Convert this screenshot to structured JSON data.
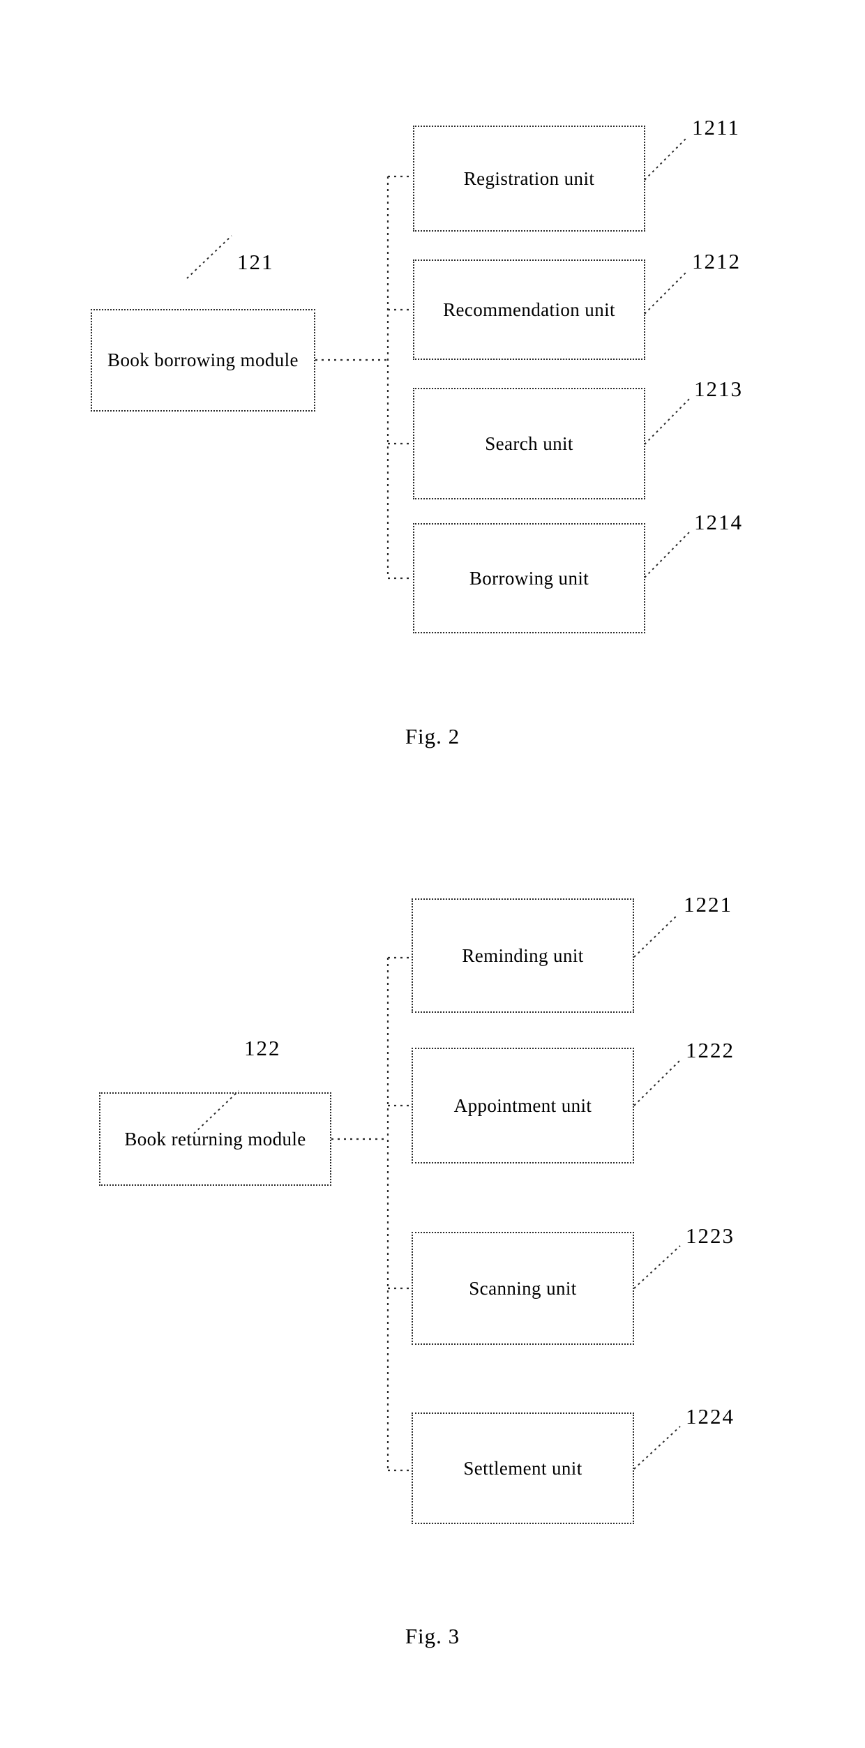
{
  "document": {
    "type": "patent-figure-sheet",
    "background_color": "#ffffff",
    "ink_color": "#000000"
  },
  "figures": [
    {
      "id": "fig2",
      "caption": "Fig. 2",
      "parent": {
        "label": "Book borrowing module",
        "ref": "121"
      },
      "children": [
        {
          "label": "Registration unit",
          "ref": "1211"
        },
        {
          "label": "Recommendation unit",
          "ref": "1212"
        },
        {
          "label": "Search unit",
          "ref": "1213"
        },
        {
          "label": "Borrowing unit",
          "ref": "1214"
        }
      ]
    },
    {
      "id": "fig3",
      "caption": "Fig. 3",
      "parent": {
        "label": "Book returning module",
        "ref": "122"
      },
      "children": [
        {
          "label": "Reminding unit",
          "ref": "1221"
        },
        {
          "label": "Appointment unit",
          "ref": "1222"
        },
        {
          "label": "Scanning unit",
          "ref": "1223"
        },
        {
          "label": "Settlement unit",
          "ref": "1224"
        }
      ]
    }
  ]
}
